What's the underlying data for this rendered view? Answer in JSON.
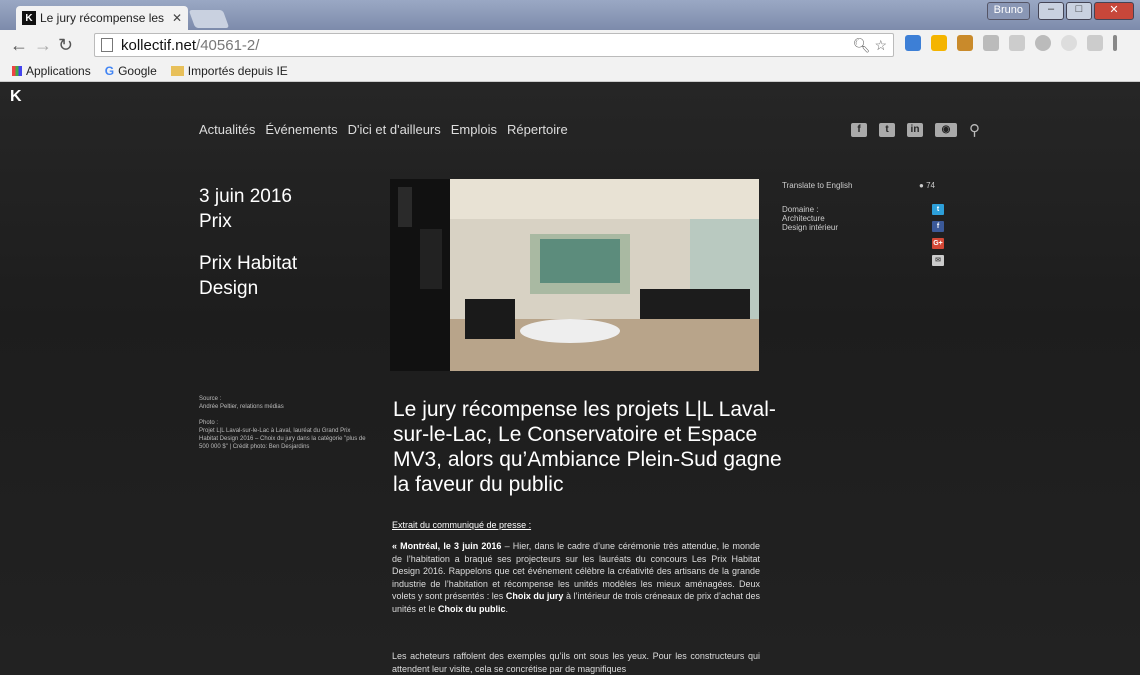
{
  "browser": {
    "tab_title": "Le jury récompense les pr",
    "user": "Bruno",
    "url_domain": "kollectif.net",
    "url_path": "/40561-2/"
  },
  "bookmarks": [
    "Applications",
    "Google",
    "Importés depuis IE"
  ],
  "site": {
    "logo": "K",
    "nav": [
      "Actualités",
      "Événements",
      "D'ici et d'ailleurs",
      "Emplois",
      "Répertoire"
    ]
  },
  "post": {
    "date": "3 juin 2016",
    "category": "Prix",
    "title": "Prix Habitat Design",
    "source_label": "Source :",
    "source": "Andrée Peltier, relations médias",
    "photo_label": "Photo :",
    "photo": "Projet L|L Laval-sur-le-Lac à Laval, lauréat du Grand Prix Habitat Design 2016 – Choix du jury dans la catégorie \"plus de 500 000 $\" | Crédit photo: Ben Desjardins",
    "headline": "Le jury récompense les projets L|L Laval-sur-le-Lac, Le Conservatoire et Espace MV3, alors qu’Ambiance Plein-Sud gagne la faveur du public",
    "extrait": "Extrait du communiqué de presse :",
    "p1_lead": "« Montréal, le 3 juin 2016",
    "p1_a": " – Hier, dans le cadre d’une cérémonie très attendue, le monde de l’habitation a braqué ses projecteurs sur les lauréats du concours Les Prix Habitat Design 2016. Rappelons que cet événement célèbre la créativité des artisans de la grande industrie de l’habitation et récompense les unités modèles les mieux aménagées. Deux volets y sont présentés : les ",
    "p1_b": "Choix du jury",
    "p1_c": " à l’intérieur de trois créneaux de prix d’achat des unités et le ",
    "p1_d": "Choix du public",
    "p1_e": ".",
    "p2": "Les acheteurs raffolent des exemples qu’ils ont sous les yeux. Pour les constructeurs qui attendent leur visite, cela se concrétise par de magnifiques",
    "translate": "Translate to English",
    "views": "74",
    "domaine_label": "Domaine :",
    "domaines": [
      "Architecture",
      "Design intérieur"
    ]
  }
}
